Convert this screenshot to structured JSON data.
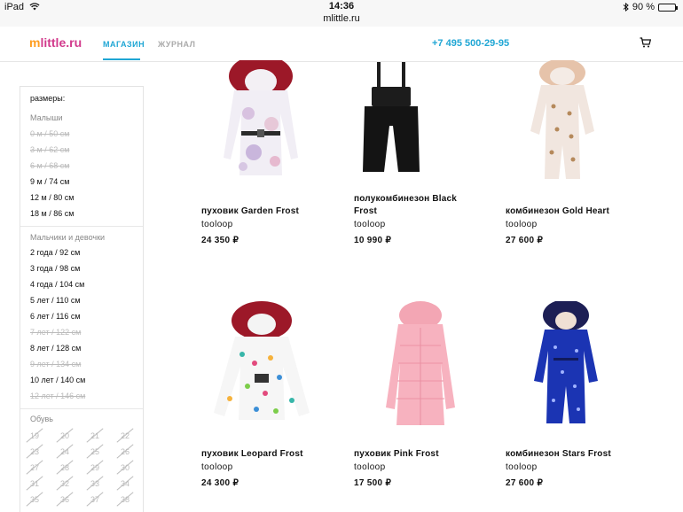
{
  "status_bar": {
    "device": "iPad",
    "time": "14:36",
    "url": "mlittle.ru",
    "battery": "90 %",
    "battery_level": 0.9
  },
  "header": {
    "logo_m": "m",
    "logo_rest": "little.ru",
    "nav_shop": "МАГАЗИН",
    "nav_journal": "ЖУРНАЛ",
    "phone": "+7 495 500-29-95"
  },
  "filters": {
    "title": "размеры:",
    "group_babies": "Малыши",
    "babies": [
      {
        "label": "0 м / 50 см",
        "available": false
      },
      {
        "label": "3 м / 62 см",
        "available": false
      },
      {
        "label": "6 м / 68 см",
        "available": false
      },
      {
        "label": "9 м / 74 см",
        "available": true
      },
      {
        "label": "12 м / 80 см",
        "available": true
      },
      {
        "label": "18 м / 86 см",
        "available": true
      }
    ],
    "group_kids": "Мальчики и девочки",
    "kids": [
      {
        "label": "2 года / 92 см",
        "available": true
      },
      {
        "label": "3 года / 98 см",
        "available": true
      },
      {
        "label": "4 года / 104 см",
        "available": true
      },
      {
        "label": "5 лет / 110 см",
        "available": true
      },
      {
        "label": "6 лет / 116 см",
        "available": true
      },
      {
        "label": "7 лет / 122 см",
        "available": false
      },
      {
        "label": "8 лет / 128 см",
        "available": true
      },
      {
        "label": "9 лет / 134 см",
        "available": false
      },
      {
        "label": "10 лет / 140 см",
        "available": true
      },
      {
        "label": "12 лет / 146 см",
        "available": false
      }
    ],
    "group_shoes": "Обувь",
    "shoes": [
      "19",
      "20",
      "21",
      "22",
      "23",
      "24",
      "25",
      "26",
      "27",
      "28",
      "29",
      "30",
      "31",
      "32",
      "33",
      "34",
      "35",
      "36",
      "37",
      "38"
    ]
  },
  "products": [
    {
      "name": "пуховик Garden Frost",
      "brand": "tooloop",
      "price": "24 350 ₽"
    },
    {
      "name": "полукомбинезон Black Frost",
      "brand": "tooloop",
      "price": "10 990 ₽"
    },
    {
      "name": "комбинезон Gold Heart",
      "brand": "tooloop",
      "price": "27 600 ₽"
    },
    {
      "name": "пуховик Leopard Frost",
      "brand": "tooloop",
      "price": "24 300 ₽"
    },
    {
      "name": "пуховик Pink Frost",
      "brand": "tooloop",
      "price": "17 500 ₽"
    },
    {
      "name": "комбинезон Stars Frost",
      "brand": "tooloop",
      "price": "27 600 ₽"
    }
  ],
  "colors": {
    "accent": "#1fa6d4",
    "logo_orange": "#ff9e22",
    "logo_pink": "#d23a8c"
  }
}
